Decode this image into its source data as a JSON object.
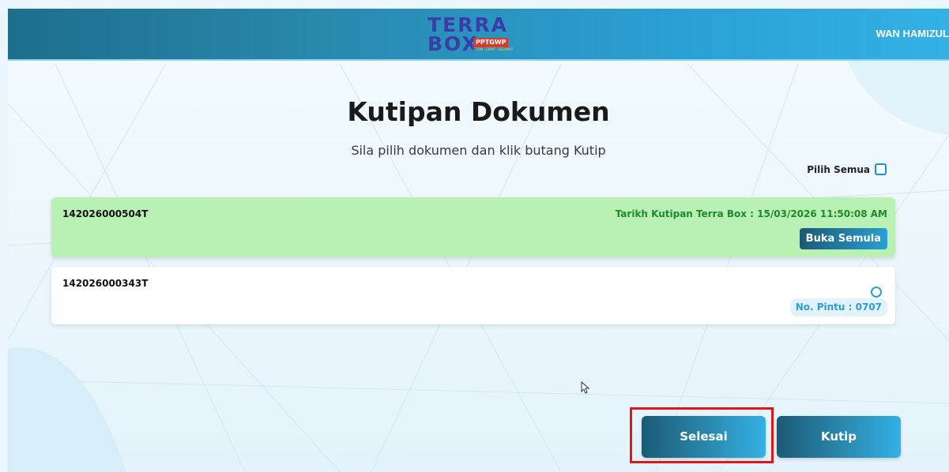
{
  "header": {
    "logo": {
      "top": "TERRA",
      "bottom": "BOX",
      "badge": "PPTGWP",
      "subtitle": "ECOM · CEPAT · SELAMAT"
    },
    "user_name": "WAN HAMIZUL"
  },
  "page": {
    "title": "Kutipan Dokumen",
    "subtitle": "Sila pilih dokumen dan klik butang Kutip",
    "select_all_label": "Pilih Semua"
  },
  "documents": [
    {
      "id": "142026000504T",
      "collected_text": "Tarikh Kutipan Terra Box : 15/03/2026 11:50:08 AM",
      "action_label": "Buka Semula"
    },
    {
      "id": "142026000343T",
      "door_label": "No. Pintu : 0707"
    }
  ],
  "actions": {
    "done_label": "Selesai",
    "collect_label": "Kutip"
  },
  "colors": {
    "accent": "#2a9fd3",
    "collected_card": "#b9f0b4",
    "collected_text": "#1e8a2a",
    "highlight": "#e21616"
  }
}
